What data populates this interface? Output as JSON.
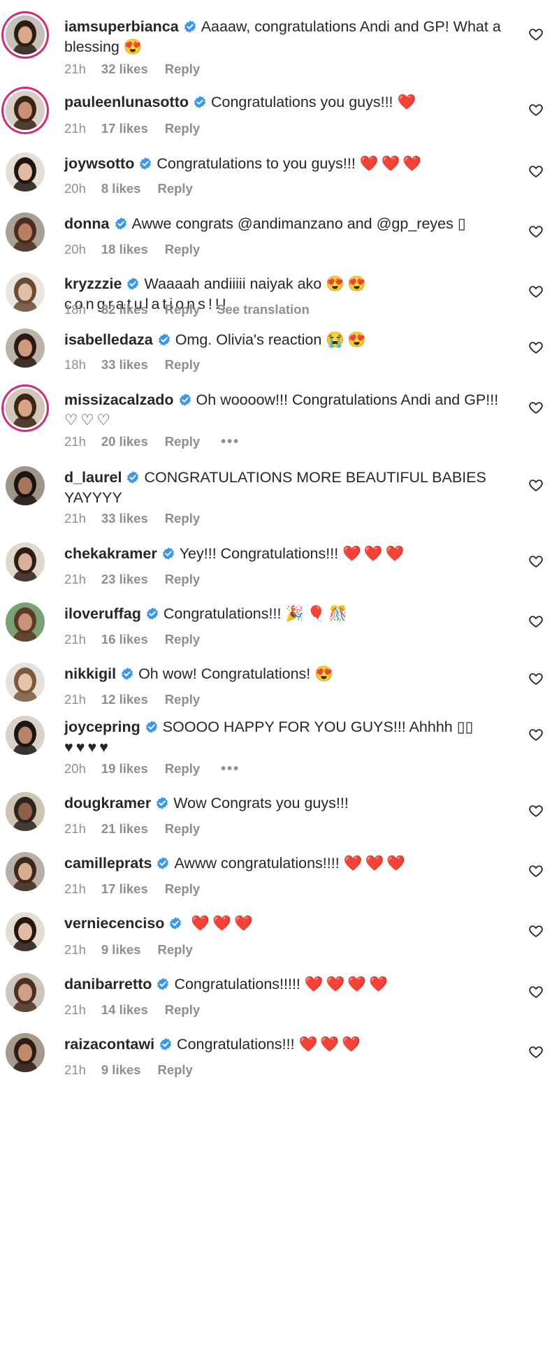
{
  "colors": {
    "verified": "#3897f0",
    "heart": "#e0202c",
    "meta": "#8e8e8e",
    "story_ring": "#d62976"
  },
  "comments": [
    {
      "username": "iamsuperbianca",
      "text": "Aaaaw, congratulations Andi and GP! What a blessing",
      "emoji": "😍",
      "time": "21h",
      "likes": "32 likes",
      "reply": "Reply",
      "story_ring": true,
      "avatar_icon": "profile-photo"
    },
    {
      "username": "pauleenlunasotto",
      "text": "Congratulations you guys!!!",
      "emoji": "❤️",
      "time": "21h",
      "likes": "17 likes",
      "reply": "Reply",
      "story_ring": true,
      "avatar_icon": "profile-photo"
    },
    {
      "username": "joywsotto",
      "text": "Congratulations to you guys!!!",
      "emoji": "❤️❤️❤️",
      "time": "20h",
      "likes": "8 likes",
      "reply": "Reply",
      "story_ring": false,
      "avatar_icon": "profile-photo"
    },
    {
      "username": "donna",
      "text": "Awwe congrats @andimanzano and @gp_reyes",
      "emoji": "▯",
      "time": "20h",
      "likes": "18 likes",
      "reply": "Reply",
      "story_ring": false,
      "avatar_icon": "profile-photo"
    },
    {
      "username": "kryzzzie",
      "text": "Waaaah andiiiii naiyak ako",
      "emoji": "😍😍 congratulations!!!",
      "time": "18h",
      "likes": "82 likes",
      "reply": "Reply",
      "extra": "See translation",
      "story_ring": false,
      "avatar_icon": "profile-photo"
    },
    {
      "username": "isabelledaza",
      "text": "Omg. Olivia's reaction",
      "emoji": "😭😍",
      "time": "18h",
      "likes": "33 likes",
      "reply": "Reply",
      "story_ring": false,
      "avatar_icon": "profile-photo"
    },
    {
      "username": "missizacalzado",
      "text": "Oh woooow!!! Congratulations Andi and GP!!!",
      "emoji": "♡♡♡",
      "time": "21h",
      "likes": "20 likes",
      "reply": "Reply",
      "more": "•••",
      "story_ring": true,
      "avatar_icon": "profile-photo"
    },
    {
      "username": "d_laurel",
      "text": "CONGRATULATIONS MORE BEAUTIFUL BABIES YAYYYY",
      "emoji": "",
      "time": "21h",
      "likes": "33 likes",
      "reply": "Reply",
      "story_ring": false,
      "avatar_icon": "profile-photo"
    },
    {
      "username": "chekakramer",
      "text": "Yey!!! Congratulations!!!",
      "emoji": "❤️❤️❤️",
      "time": "21h",
      "likes": "23 likes",
      "reply": "Reply",
      "story_ring": false,
      "avatar_icon": "profile-photo"
    },
    {
      "username": "iloveruffag",
      "text": "Congratulations!!!",
      "emoji": "🎉🎈🎊",
      "time": "21h",
      "likes": "16 likes",
      "reply": "Reply",
      "story_ring": false,
      "avatar_icon": "profile-photo"
    },
    {
      "username": "nikkigil",
      "text": "Oh wow! Congratulations!",
      "emoji": "😍",
      "time": "21h",
      "likes": "12 likes",
      "reply": "Reply",
      "story_ring": false,
      "avatar_icon": "profile-photo"
    },
    {
      "username": "joycepring",
      "text": "SOOOO HAPPY FOR YOU GUYS!!! Ahhhh ▯▯",
      "emoji": "♥♥♥♥",
      "time": "20h",
      "likes": "19 likes",
      "reply": "Reply",
      "more": "•••",
      "story_ring": false,
      "avatar_icon": "profile-photo"
    },
    {
      "username": "dougkramer",
      "text": "Wow Congrats you guys!!!",
      "emoji": "",
      "time": "21h",
      "likes": "21 likes",
      "reply": "Reply",
      "story_ring": false,
      "avatar_icon": "profile-photo"
    },
    {
      "username": "camilleprats",
      "text": "Awww congratulations!!!!",
      "emoji": "❤️❤️❤️",
      "time": "21h",
      "likes": "17 likes",
      "reply": "Reply",
      "story_ring": false,
      "avatar_icon": "profile-photo"
    },
    {
      "username": "verniecenciso",
      "text": "",
      "emoji": "❤️❤️❤️",
      "time": "21h",
      "likes": "9 likes",
      "reply": "Reply",
      "story_ring": false,
      "avatar_icon": "profile-photo"
    },
    {
      "username": "danibarretto",
      "text": "Congratulations!!!!!",
      "emoji": "❤️❤️❤️❤️",
      "time": "21h",
      "likes": "14 likes",
      "reply": "Reply",
      "story_ring": false,
      "avatar_icon": "profile-photo"
    },
    {
      "username": "raizacontawi",
      "text": "Congratulations!!!",
      "emoji": "❤️❤️❤️",
      "time": "21h",
      "likes": "9 likes",
      "reply": "Reply",
      "story_ring": false,
      "avatar_icon": "profile-photo"
    }
  ]
}
